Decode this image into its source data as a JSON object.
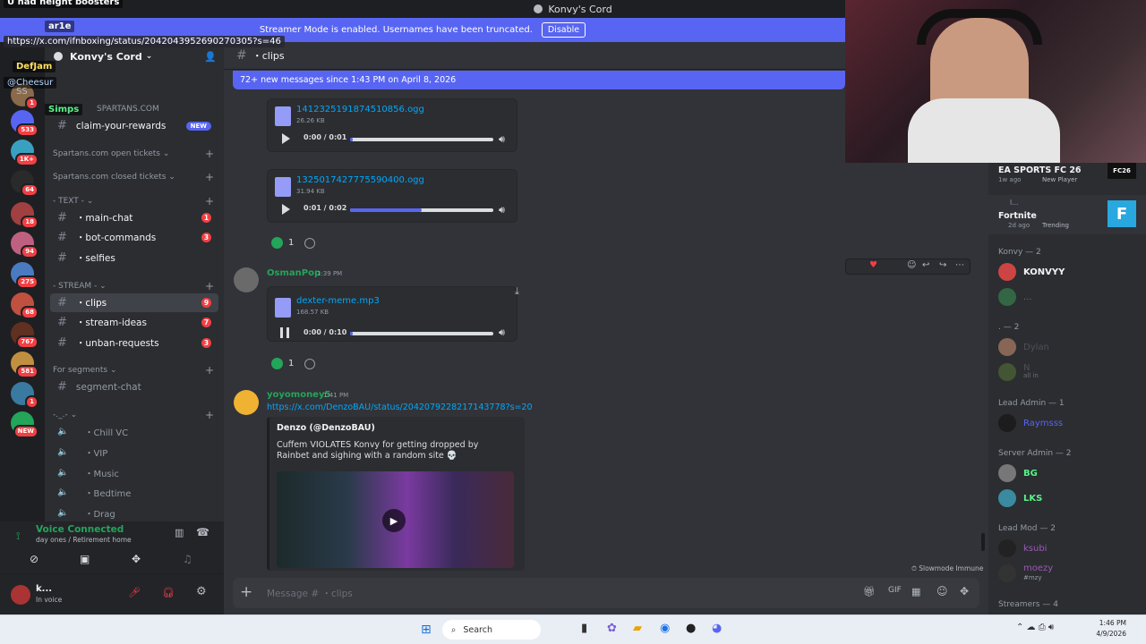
{
  "window": {
    "title": "Konvy's Cord"
  },
  "banner": {
    "text": "Streamer Mode is enabled. Usernames have been truncated.",
    "button": "Disable"
  },
  "overlay": {
    "top_text": "U had height boosters",
    "user1": "ar1e",
    "link": "https://x.com/ifnboxing/status/2042043952690270305?s=46",
    "user2": "DefJam",
    "user3": "@Cheesur",
    "user4": "Simps",
    "user5": "SS"
  },
  "server": {
    "name": "Konvy's Cord"
  },
  "rail_badges": [
    "1",
    "533",
    "1K+",
    "64",
    "18",
    "94",
    "275",
    "68",
    "767",
    "581",
    "1",
    "NEW"
  ],
  "channels": {
    "cat_spartans": "SPARTANS.COM",
    "claim": "claim-your-rewards",
    "claim_badge": "NEW",
    "cat_open": "Spartans.com open tickets",
    "cat_closed": "Spartans.com closed tickets",
    "cat_text": "- TEXT -",
    "main_chat": "・main-chat",
    "main_chat_badge": "1",
    "bot_commands": "・bot-commands",
    "bot_commands_badge": "3",
    "selfies": "・selfies",
    "cat_stream": "- STREAM -",
    "clips": "・clips",
    "clips_badge": "9",
    "stream_ideas": "・stream-ideas",
    "stream_ideas_badge": "7",
    "unban": "・unban-requests",
    "unban_badge": "3",
    "cat_segments": "For segments",
    "segment_chat": "segment-chat",
    "cat_voice": "-._.-",
    "voice": [
      "・Chill VC",
      "・VIP",
      "・Music",
      "・Bedtime",
      "・Drag"
    ]
  },
  "voice_panel": {
    "status": "Voice Connected",
    "location": "day ones / Retirement home"
  },
  "user_panel": {
    "name": "k...",
    "status": "In voice"
  },
  "chat_header": {
    "channel": "・clips"
  },
  "new_messages": "72+ new messages since 1:43 PM on April 8, 2026",
  "messages": {
    "audio1": {
      "name": "1412325191874510856.ogg",
      "size": "26.26 KB",
      "time": "0:00 / 0:01",
      "progress": 0.0
    },
    "audio2": {
      "name": "1325017427775590400.ogg",
      "size": "31.94 KB",
      "time": "0:01 / 0:02",
      "progress": 0.5
    },
    "reaction1_count": "1",
    "msg2": {
      "user": "OsmanPop",
      "time": "1:39 PM",
      "audio": {
        "name": "dexter-meme.mp3",
        "size": "168.57 KB",
        "time": "0:00 / 0:10",
        "progress": 0.0
      },
      "reaction_count": "1"
    },
    "msg3": {
      "user": "yoyomoney5",
      "time": "1:41 PM",
      "link": "https://x.com/DenzoBAU/status/2042079228217143778?s=20",
      "embed_author": "Denzo (@DenzoBAU)",
      "embed_text": "Cuffem VIOLATES Konvy for getting dropped by Rainbet and sighing with a random site 💀"
    }
  },
  "slowmode": "Slowmode Immune",
  "composer": {
    "placeholder": "Message # ・clips"
  },
  "activities": [
    {
      "title": "EA SPORTS FC 26",
      "meta": "1w ago",
      "tag": "New Player",
      "logo": "FC26"
    },
    {
      "title": "Fortnite",
      "meta": "2d ago",
      "tag": "Trending",
      "prefix": "I...",
      "logo": "F"
    }
  ],
  "members": {
    "konvy_head": "Konvy — 2",
    "konvy_members": [
      "KONVYY",
      "..."
    ],
    "dot_head": ". — 2",
    "dot_members": [
      "Dylan",
      "N",
      "all in"
    ],
    "lead_admin_head": "Lead Admin — 1",
    "lead_admin": "Raymsss",
    "server_admin_head": "Server Admin — 2",
    "server_admin": [
      "BG",
      "LKS"
    ],
    "lead_mod_head": "Lead Mod — 2",
    "lead_mod": [
      "ksubi",
      "moezy",
      "#mzy"
    ],
    "streamers_head": "Streamers — 4"
  },
  "taskbar": {
    "search": "Search",
    "time": "1:46 PM",
    "date": "4/9/2026"
  },
  "colors": {
    "accent": "#5865f2",
    "red": "#f23f43",
    "green": "#23a55a",
    "link": "#00a8fc"
  }
}
